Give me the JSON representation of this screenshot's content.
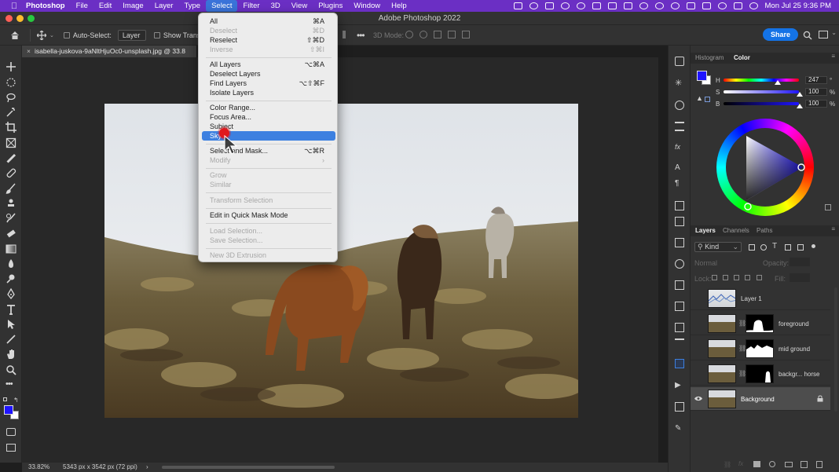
{
  "menubar": {
    "app_name": "Photoshop",
    "menus": [
      "File",
      "Edit",
      "Image",
      "Layer",
      "Type",
      "Select",
      "Filter",
      "3D",
      "View",
      "Plugins",
      "Window",
      "Help"
    ],
    "active_menu": "Select",
    "clock": "Mon Jul 25  9:36 PM"
  },
  "window": {
    "title": "Adobe Photoshop 2022"
  },
  "options_bar": {
    "auto_select_label": "Auto-Select:",
    "auto_select_value": "Layer",
    "show_transform_label": "Show Transform",
    "mode_3d_label": "3D Mode:",
    "share_label": "Share"
  },
  "document": {
    "tab_title": "isabella-juskova-9aNltHjuOc0-unsplash.jpg @ 33.8",
    "zoom": "33.82%",
    "doc_info": "5343 px x 3542 px (72 ppi)"
  },
  "select_menu": {
    "items": [
      {
        "label": "All",
        "shortcut": "⌘A",
        "enabled": true
      },
      {
        "label": "Deselect",
        "shortcut": "⌘D",
        "enabled": false
      },
      {
        "label": "Reselect",
        "shortcut": "⇧⌘D",
        "enabled": true
      },
      {
        "label": "Inverse",
        "shortcut": "⇧⌘I",
        "enabled": false
      },
      {
        "label": "All Layers",
        "shortcut": "⌥⌘A",
        "enabled": true
      },
      {
        "label": "Deselect Layers",
        "shortcut": "",
        "enabled": true
      },
      {
        "label": "Find Layers",
        "shortcut": "⌥⇧⌘F",
        "enabled": true
      },
      {
        "label": "Isolate Layers",
        "shortcut": "",
        "enabled": true
      },
      {
        "label": "Color Range...",
        "shortcut": "",
        "enabled": true
      },
      {
        "label": "Focus Area...",
        "shortcut": "",
        "enabled": true
      },
      {
        "label": "Subject",
        "shortcut": "",
        "enabled": true
      },
      {
        "label": "Sky",
        "shortcut": "",
        "enabled": true,
        "highlighted": true
      },
      {
        "label": "Select and Mask...",
        "shortcut": "⌥⌘R",
        "enabled": true
      },
      {
        "label": "Modify",
        "shortcut": "›",
        "enabled": false
      },
      {
        "label": "Grow",
        "shortcut": "",
        "enabled": false
      },
      {
        "label": "Similar",
        "shortcut": "",
        "enabled": false
      },
      {
        "label": "Transform Selection",
        "shortcut": "",
        "enabled": false
      },
      {
        "label": "Edit in Quick Mask Mode",
        "shortcut": "",
        "enabled": true
      },
      {
        "label": "Load Selection...",
        "shortcut": "",
        "enabled": false
      },
      {
        "label": "Save Selection...",
        "shortcut": "",
        "enabled": false
      },
      {
        "label": "New 3D Extrusion",
        "shortcut": "",
        "enabled": false
      }
    ]
  },
  "color_panel": {
    "tabs": [
      "Histogram",
      "Color"
    ],
    "active_tab": "Color",
    "h_label": "H",
    "h_value": "247",
    "h_unit": "°",
    "s_label": "S",
    "s_value": "100",
    "s_unit": "%",
    "b_label": "B",
    "b_value": "100",
    "b_unit": "%",
    "foreground_color": "#1f14ff",
    "background_color": "#ffffff"
  },
  "layers_panel": {
    "tabs": [
      "Layers",
      "Channels",
      "Paths"
    ],
    "active_tab": "Layers",
    "kind_label": "Kind",
    "blend_mode": "Normal",
    "opacity_label": "Opacity:",
    "lock_label": "Lock:",
    "fill_label": "Fill:",
    "layers": [
      {
        "name": "Layer 1",
        "visible": false,
        "has_mask": false,
        "selected": false
      },
      {
        "name": "foreground",
        "visible": false,
        "has_mask": true,
        "selected": false
      },
      {
        "name": "mid ground",
        "visible": false,
        "has_mask": true,
        "selected": false
      },
      {
        "name": "backgr... horse",
        "visible": false,
        "has_mask": true,
        "selected": false
      },
      {
        "name": "Background",
        "visible": true,
        "has_mask": false,
        "selected": true,
        "locked": true
      }
    ]
  },
  "accent": "#1473e6"
}
